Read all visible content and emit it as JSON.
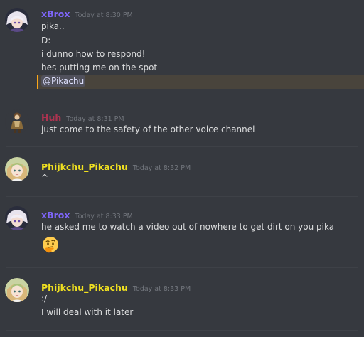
{
  "colors": {
    "xbrox": "#7f66fc",
    "huh": "#ad3350",
    "pikachu": "#f0e020",
    "mention_bg": "#49443c",
    "mention_bar": "#faa61a"
  },
  "messages": [
    {
      "author": "xBrox",
      "timestamp": "Today at 8:30 PM",
      "avatar_icon": "white-haired-anime-avatar-icon",
      "lines": [
        "pika..",
        "D:",
        "i dunno how to respond!",
        "hes putting me on the spot"
      ],
      "mention": "@Pikachu"
    },
    {
      "author": "Huh",
      "timestamp": "Today at 8:31 PM",
      "avatar_icon": "small-character-avatar-icon",
      "lines": [
        "just come to the safety of the other voice channel"
      ]
    },
    {
      "author": "Phijkchu_Pikachu",
      "timestamp": "Today at 8:32 PM",
      "avatar_icon": "anime-girl-avatar-icon",
      "lines": [
        "^"
      ]
    },
    {
      "author": "xBrox",
      "timestamp": "Today at 8:33 PM",
      "avatar_icon": "white-haired-anime-avatar-icon",
      "lines": [
        "he asked me to watch a video out of nowhere to get dirt on you pika"
      ],
      "emoji": "thinking-face-emoji"
    },
    {
      "author": "Phijkchu_Pikachu",
      "timestamp": "Today at 8:33 PM",
      "avatar_icon": "anime-girl-avatar-icon",
      "lines": [
        ":/",
        "I will deal with it later"
      ]
    }
  ]
}
